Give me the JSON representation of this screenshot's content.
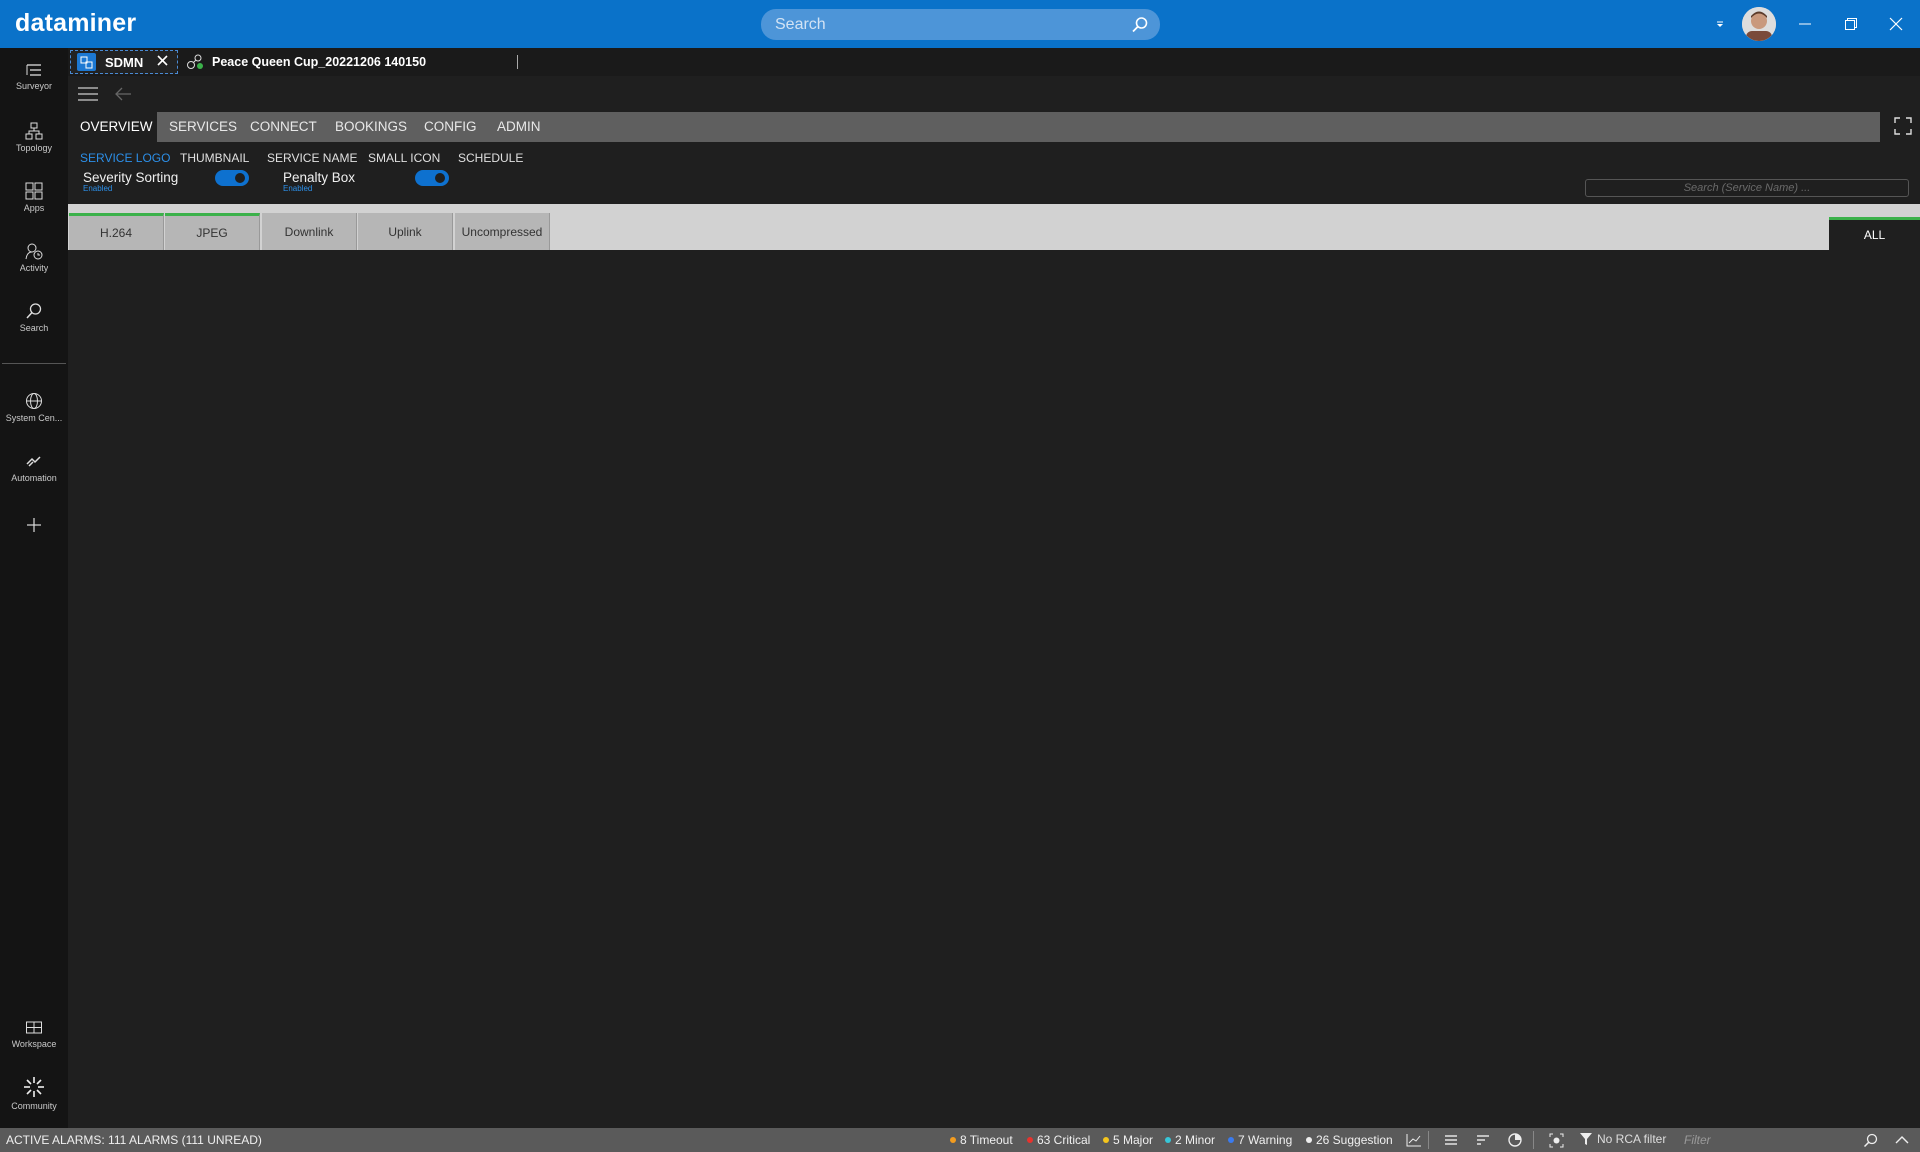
{
  "app": {
    "logo": "dataminer",
    "search_placeholder": "Search"
  },
  "sidebar": {
    "top_items": [
      {
        "label": "Surveyor",
        "icon": "surveyor-icon"
      },
      {
        "label": "Topology",
        "icon": "topology-icon"
      },
      {
        "label": "Apps",
        "icon": "apps-icon"
      },
      {
        "label": "Activity",
        "icon": "activity-icon"
      },
      {
        "label": "Search",
        "icon": "search-icon"
      }
    ],
    "mid_items": [
      {
        "label": "System Cen...",
        "icon": "globe-icon"
      },
      {
        "label": "Automation",
        "icon": "automation-icon"
      }
    ],
    "bottom_items": [
      {
        "label": "Workspace",
        "icon": "workspace-icon"
      },
      {
        "label": "Community",
        "icon": "community-icon"
      }
    ]
  },
  "tabs": [
    {
      "label": "SDMN",
      "active": true
    },
    {
      "label": "Peace Queen Cup_20221206 140150",
      "active": false
    }
  ],
  "menu": [
    "OVERVIEW",
    "SERVICES",
    "CONNECT",
    "BOOKINGS",
    "CONFIG",
    "ADMIN"
  ],
  "menu_active": "OVERVIEW",
  "sub_tabs": [
    "SERVICE LOGO",
    "THUMBNAIL",
    "SERVICE NAME",
    "SMALL ICON",
    "SCHEDULE"
  ],
  "sub_tab_active": "SERVICE LOGO",
  "toggles": [
    {
      "label": "Severity Sorting",
      "state": "Enabled",
      "on": true
    },
    {
      "label": "Penalty Box",
      "state": "Enabled",
      "on": true
    }
  ],
  "service_search_placeholder": "Search (Service Name) ...",
  "filter_tabs": [
    {
      "label": "H.264",
      "active": true
    },
    {
      "label": "JPEG",
      "active": true
    },
    {
      "label": "Downlink",
      "active": false
    },
    {
      "label": "Uplink",
      "active": false
    },
    {
      "label": "Uncompressed",
      "active": false
    }
  ],
  "filter_all": "ALL",
  "status": {
    "active_alarms": "ACTIVE ALARMS: 111 ALARMS (111 UNREAD)",
    "severities": [
      {
        "label": "8 Timeout",
        "color": "#f39c1f"
      },
      {
        "label": "63 Critical",
        "color": "#e8322d"
      },
      {
        "label": "5 Major",
        "color": "#f5c51c"
      },
      {
        "label": "2 Minor",
        "color": "#37c7d9"
      },
      {
        "label": "7 Warning",
        "color": "#3a7bf0"
      },
      {
        "label": "26 Suggestion",
        "color": "#eeeeee"
      }
    ],
    "rca": "No RCA filter",
    "filter_placeholder": "Filter"
  },
  "colors": {
    "brand": "#0a72c9",
    "accent_green": "#3bb14a",
    "toggle_blue": "#0e71cf"
  }
}
